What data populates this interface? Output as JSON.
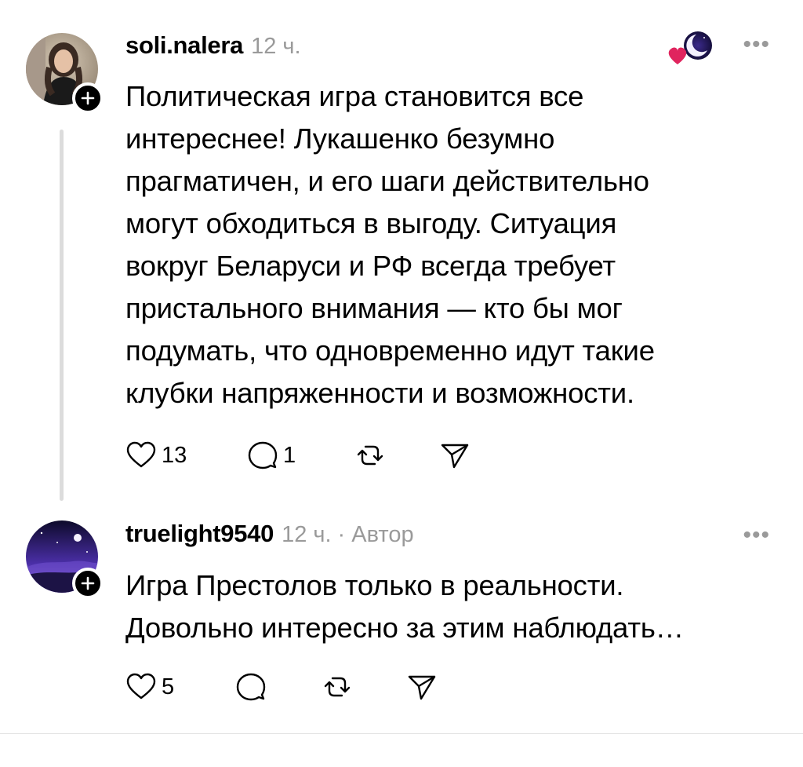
{
  "comments": [
    {
      "username": "soli.nalera",
      "time": "12 ч.",
      "text_lines": [
        "Политическая игра становится все",
        "интереснее! Лукашенко безумно",
        "прагматичен, и его шаги действительно",
        "могут обходиться в выгоду. Ситуация",
        "вокруг Беларуси и РФ всегда требует",
        "пристального внимания — кто бы мог",
        "подумать, что одновременно идут такие",
        "клубки напряженности и возможности."
      ],
      "likes": "13",
      "replies": "1",
      "more_label": "•••",
      "reaction_icon": "heart-moon-emoji-icon"
    },
    {
      "username": "truelight9540",
      "time": "12 ч.",
      "author_tag": "· Автор",
      "text_lines": [
        "Игра Престолов только в реальности.",
        "Довольно интересно за этим наблюдать…"
      ],
      "likes": "5",
      "replies": "",
      "more_label": "•••"
    }
  ],
  "colors": {
    "text": "#000000",
    "muted": "#9a9a9a",
    "thread_line": "#dcdcdc",
    "divider": "#e3e3e3",
    "heart": "#e0245e"
  }
}
